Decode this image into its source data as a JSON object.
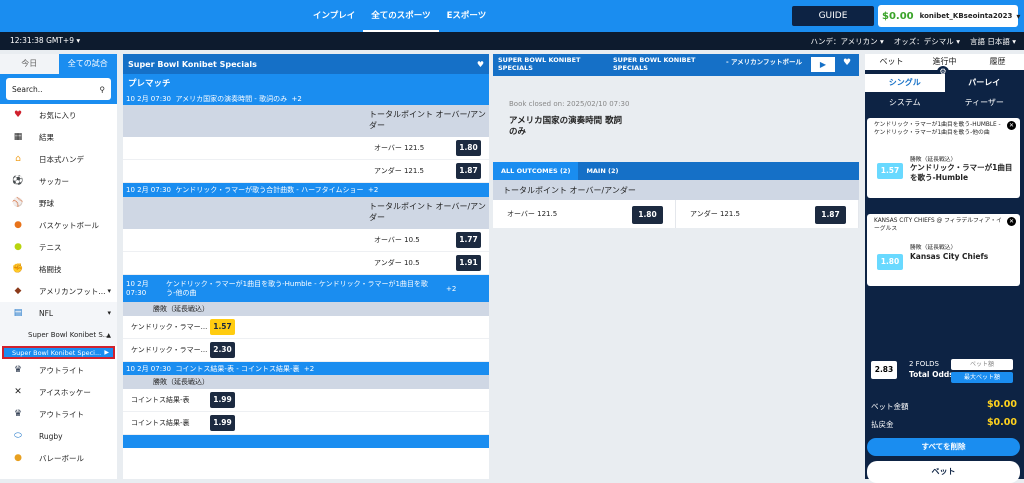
{
  "topnav": {
    "items": [
      "インプレイ",
      "全てのスポーツ",
      "Eスポーツ"
    ],
    "guide": "GUIDE"
  },
  "account": {
    "balance": "$0.00",
    "username": "konibet_KBseointa2023"
  },
  "statusbar": {
    "clock": "12:31:38 GMT+9",
    "handicap": "ハンデ：アメリカン",
    "odds": "オッズ：デシマル",
    "language": "言語 日本語"
  },
  "sidebar": {
    "tabs": [
      "今日",
      "全ての試合"
    ],
    "search_placeholder": "Search..",
    "items": [
      {
        "label": "お気に入り",
        "icon": "heart-icon"
      },
      {
        "label": "結果",
        "icon": "calendar-icon"
      },
      {
        "label": "日本式ハンデ",
        "icon": "home-icon"
      },
      {
        "label": "サッカー",
        "icon": "soccer-icon"
      },
      {
        "label": "野球",
        "icon": "baseball-icon"
      },
      {
        "label": "バスケットボール",
        "icon": "basketball-icon"
      },
      {
        "label": "テニス",
        "icon": "tennis-icon"
      },
      {
        "label": "格闘技",
        "icon": "glove-icon"
      },
      {
        "label": "アメリカンフット...",
        "icon": "football-icon"
      }
    ],
    "nfl": "NFL",
    "sub1": "Super Bowl Konibet S...",
    "sub2": "Super Bowl Konibet Speci...",
    "items2": [
      {
        "label": "アウトライト",
        "icon": "medal-icon"
      },
      {
        "label": "アイスホッケー",
        "icon": "hockey-icon"
      },
      {
        "label": "アウトライト",
        "icon": "medal-icon"
      },
      {
        "label": "Rugby",
        "icon": "rugby-icon"
      },
      {
        "label": "バレーボール",
        "icon": "volleyball-icon"
      }
    ]
  },
  "middle": {
    "header": "Super Bowl Konibet Specials",
    "prematch": "プレマッチ",
    "events": [
      {
        "date": "10 2月 07:30",
        "name": "アメリカ国家の演奏時間 - 歌詞のみ",
        "more": "+2",
        "market": "トータルポイント オーバー/アンダー",
        "rows": [
          {
            "label": "オーバー 121.5",
            "odd": "1.80"
          },
          {
            "label": "アンダー 121.5",
            "odd": "1.87"
          }
        ]
      },
      {
        "date": "10 2月 07:30",
        "name": "ケンドリック・ラマーが歌う合計曲数 - ハーフタイムショー",
        "more": "+2",
        "market": "トータルポイント オーバー/アンダー",
        "rows": [
          {
            "label": "オーバー 10.5",
            "odd": "1.77"
          },
          {
            "label": "アンダー 10.5",
            "odd": "1.91"
          }
        ]
      }
    ],
    "event3": {
      "date1": "10 2月",
      "date2": "07:30",
      "name": "ケンドリック・ラマーが1曲目を歌う-Humble - ケンドリック・ラマーが1曲目を歌う-他の曲",
      "more": "+2",
      "market": "勝敗（延長戦込）",
      "rows": [
        {
          "label": "ケンドリック・ラマー...",
          "odd": "1.57"
        },
        {
          "label": "ケンドリック・ラマー...",
          "odd": "2.30"
        }
      ]
    },
    "event4": {
      "date": "10 2月 07:30",
      "name": "コイントス結果-表 - コイントス結果-裏",
      "more": "+2",
      "market": "勝敗（延長戦込）",
      "rows": [
        {
          "label": "コイントス結果-表",
          "odd": "1.99"
        },
        {
          "label": "コイントス結果-裏",
          "odd": "1.99"
        }
      ]
    }
  },
  "center": {
    "crumbs": [
      "SUPER BOWL KONIBET SPECIALS",
      "SUPER BOWL KONIBET SPECIALS",
      "- アメリカンフットボール"
    ],
    "closed": "Book closed on: 2025/02/10 07:30",
    "title": "アメリカ国家の演奏時間 歌詞のみ",
    "tabs": [
      "ALL OUTCOMES (2)",
      "MAIN (2)"
    ],
    "market": "トータルポイント オーバー/アンダー",
    "odds": [
      {
        "label": "オーバー 121.5",
        "odd": "1.80"
      },
      {
        "label": "アンダー 121.5",
        "odd": "1.87"
      }
    ]
  },
  "betslip": {
    "tabs": [
      "ベット",
      "進行中",
      "履歴"
    ],
    "seg1": [
      "シングル",
      "パーレイ"
    ],
    "seg2": [
      "システム",
      "ティーザー"
    ],
    "slips": [
      {
        "desc": "ケンドリック・ラマーが1曲目を歌う-HUMBLE - ケンドリック・ラマーが1曲目を歌う-他の曲",
        "odd": "1.57",
        "market": "勝敗（延長戦込）",
        "pick": "ケンドリック・ラマーが1曲目を歌う-Humble"
      },
      {
        "desc": "KANSAS CITY CHIEFS @ フィラデルフィア・イーグルス",
        "odd": "1.80",
        "market": "勝敗（延長戦込）",
        "pick": "Kansas City Chiefs"
      }
    ],
    "folds": {
      "odd": "2.83",
      "label": "2 FOLDS",
      "total": "Total Odds",
      "input_placeholder": "ベット額",
      "max": "最大ベット額"
    },
    "stake_label": "ベット金額",
    "stake": "$0.00",
    "payout_label": "払戻金",
    "payout": "$0.00",
    "clear": "すべてを削除",
    "bet": "ベット"
  }
}
